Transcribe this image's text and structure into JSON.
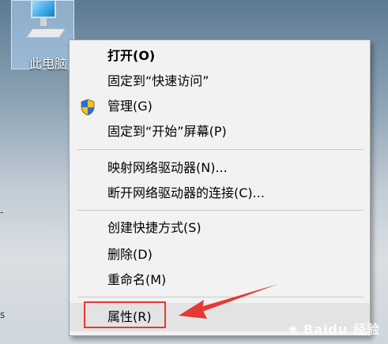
{
  "desktop": {
    "icon_label": "此电脑",
    "edge_marks": [
      "-",
      "s"
    ]
  },
  "menu": {
    "items": [
      {
        "label": "打开(O)",
        "bold": true
      },
      {
        "label": "固定到“快速访问”"
      },
      {
        "label": "管理(G)",
        "icon": "uac-shield-icon"
      },
      {
        "label": "固定到“开始”屏幕(P)"
      },
      {
        "label": "映射网络驱动器(N)..."
      },
      {
        "label": "断开网络驱动器的连接(C)..."
      },
      {
        "label": "创建快捷方式(S)"
      },
      {
        "label": "删除(D)"
      },
      {
        "label": "重命名(M)"
      },
      {
        "label": "属性(R)",
        "highlighted": true
      }
    ]
  },
  "annotation": {
    "color": "#e53935"
  },
  "watermark": {
    "brand": "Baidu",
    "suffix": "经验"
  }
}
